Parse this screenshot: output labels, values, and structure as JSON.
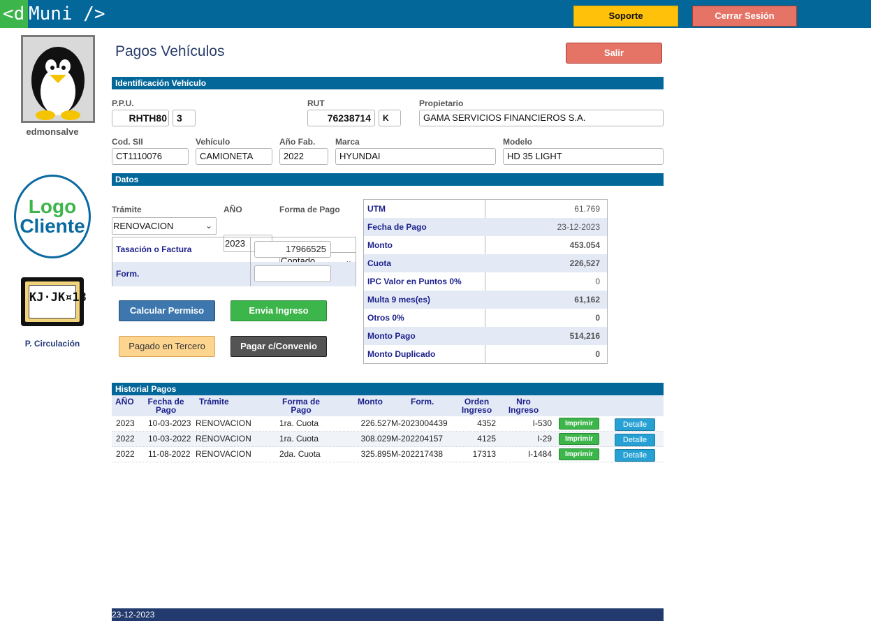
{
  "topbar": {
    "logo_part1": "<d",
    "logo_part2": "Muni />",
    "support_label": "Soporte",
    "logout_label": "Cerrar Sesión",
    "color": "#04679a"
  },
  "sidebar": {
    "username": "edmonsalve",
    "client_logo_line1": "Logo",
    "client_logo_line2": "Cliente",
    "plate_text": "KJ·JK¤18",
    "plate_caption": "CHILE",
    "circulation_label": "P. Circulación"
  },
  "page": {
    "title": "Pagos Vehículos",
    "exit_label": "Salir"
  },
  "vehicle_id": {
    "section_title": "Identificación Vehículo",
    "ppu_label": "P.P.U.",
    "ppu_value": "RHTH80",
    "ppu_dv": "3",
    "rut_label": "RUT",
    "rut_value": "76238714",
    "rut_dv": "K",
    "owner_label": "Propietario",
    "owner_value": "GAMA SERVICIOS FINANCIEROS S.A.",
    "sii_label": "Cod. SII",
    "sii_value": "CT1110076",
    "vehicle_label": "Vehículo",
    "vehicle_value": "CAMIONETA",
    "year_label": "Año Fab.",
    "year_value": "2022",
    "brand_label": "Marca",
    "brand_value": "HYUNDAI",
    "model_label": "Modelo",
    "model_value": "HD 35 LIGHT"
  },
  "datos": {
    "section_title": "Datos",
    "tramite_label": "Trámite",
    "tramite_value": "RENOVACION",
    "anio_label": "AÑO",
    "anio_value": "2023",
    "forma_label": "Forma de Pago",
    "forma_value": "Contado",
    "tasacion_label": "Tasación o Factura",
    "tasacion_value": "17966525",
    "form_label": "Form.",
    "form_value": "",
    "buttons": {
      "calcular": "Calcular Permiso",
      "envia": "Envia Ingreso",
      "tercero": "Pagado en Tercero",
      "convenio": "Pagar c/Convenio"
    }
  },
  "summary": [
    {
      "label": "UTM",
      "value": "61.769",
      "bold": false
    },
    {
      "label": "Fecha de Pago",
      "value": "23-12-2023",
      "bold": false
    },
    {
      "label": "Monto",
      "value": "453.054",
      "bold": true
    },
    {
      "label": "Cuota",
      "value": "226,527",
      "bold": true
    },
    {
      "label": "IPC Valor en Puntos 0%",
      "value": "0",
      "bold": false
    },
    {
      "label": "Multa 9 mes(es)",
      "value": "61,162",
      "bold": true
    },
    {
      "label": "Otros 0%",
      "value": "0",
      "bold": true
    },
    {
      "label": "Monto Pago",
      "value": "514,216",
      "bold": true
    },
    {
      "label": "Monto Duplicado",
      "value": "0",
      "bold": true
    }
  ],
  "history": {
    "section_title": "Historial Pagos",
    "headers": {
      "anio": "AÑO",
      "fecha_1": "Fecha de",
      "fecha_2": "Pago",
      "tramite": "Trámite",
      "forma_1": "Forma de",
      "forma_2": "Pago",
      "monto": "Monto",
      "form": "Form.",
      "orden_1": "Orden",
      "orden_2": "Ingreso",
      "nro_1": "Nro",
      "nro_2": "Ingreso"
    },
    "print_label": "Imprimir",
    "detail_label": "Detalle",
    "rows": [
      {
        "anio": "2023",
        "fecha": "10-03-2023",
        "tramite": "RENOVACION",
        "forma": "1ra. Cuota",
        "monto": "226.527",
        "form": "M-2023004439",
        "orden": "4352",
        "nro": "I-530"
      },
      {
        "anio": "2022",
        "fecha": "10-03-2022",
        "tramite": "RENOVACION",
        "forma": "1ra. Cuota",
        "monto": "308.029",
        "form": "M-202204157",
        "orden": "4125",
        "nro": "I-29"
      },
      {
        "anio": "2022",
        "fecha": "11-08-2022",
        "tramite": "RENOVACION",
        "forma": "2da. Cuota",
        "monto": "325.895",
        "form": "M-202217438",
        "orden": "17313",
        "nro": "I-1484"
      }
    ]
  },
  "footer": {
    "date": "23-12-2023"
  }
}
